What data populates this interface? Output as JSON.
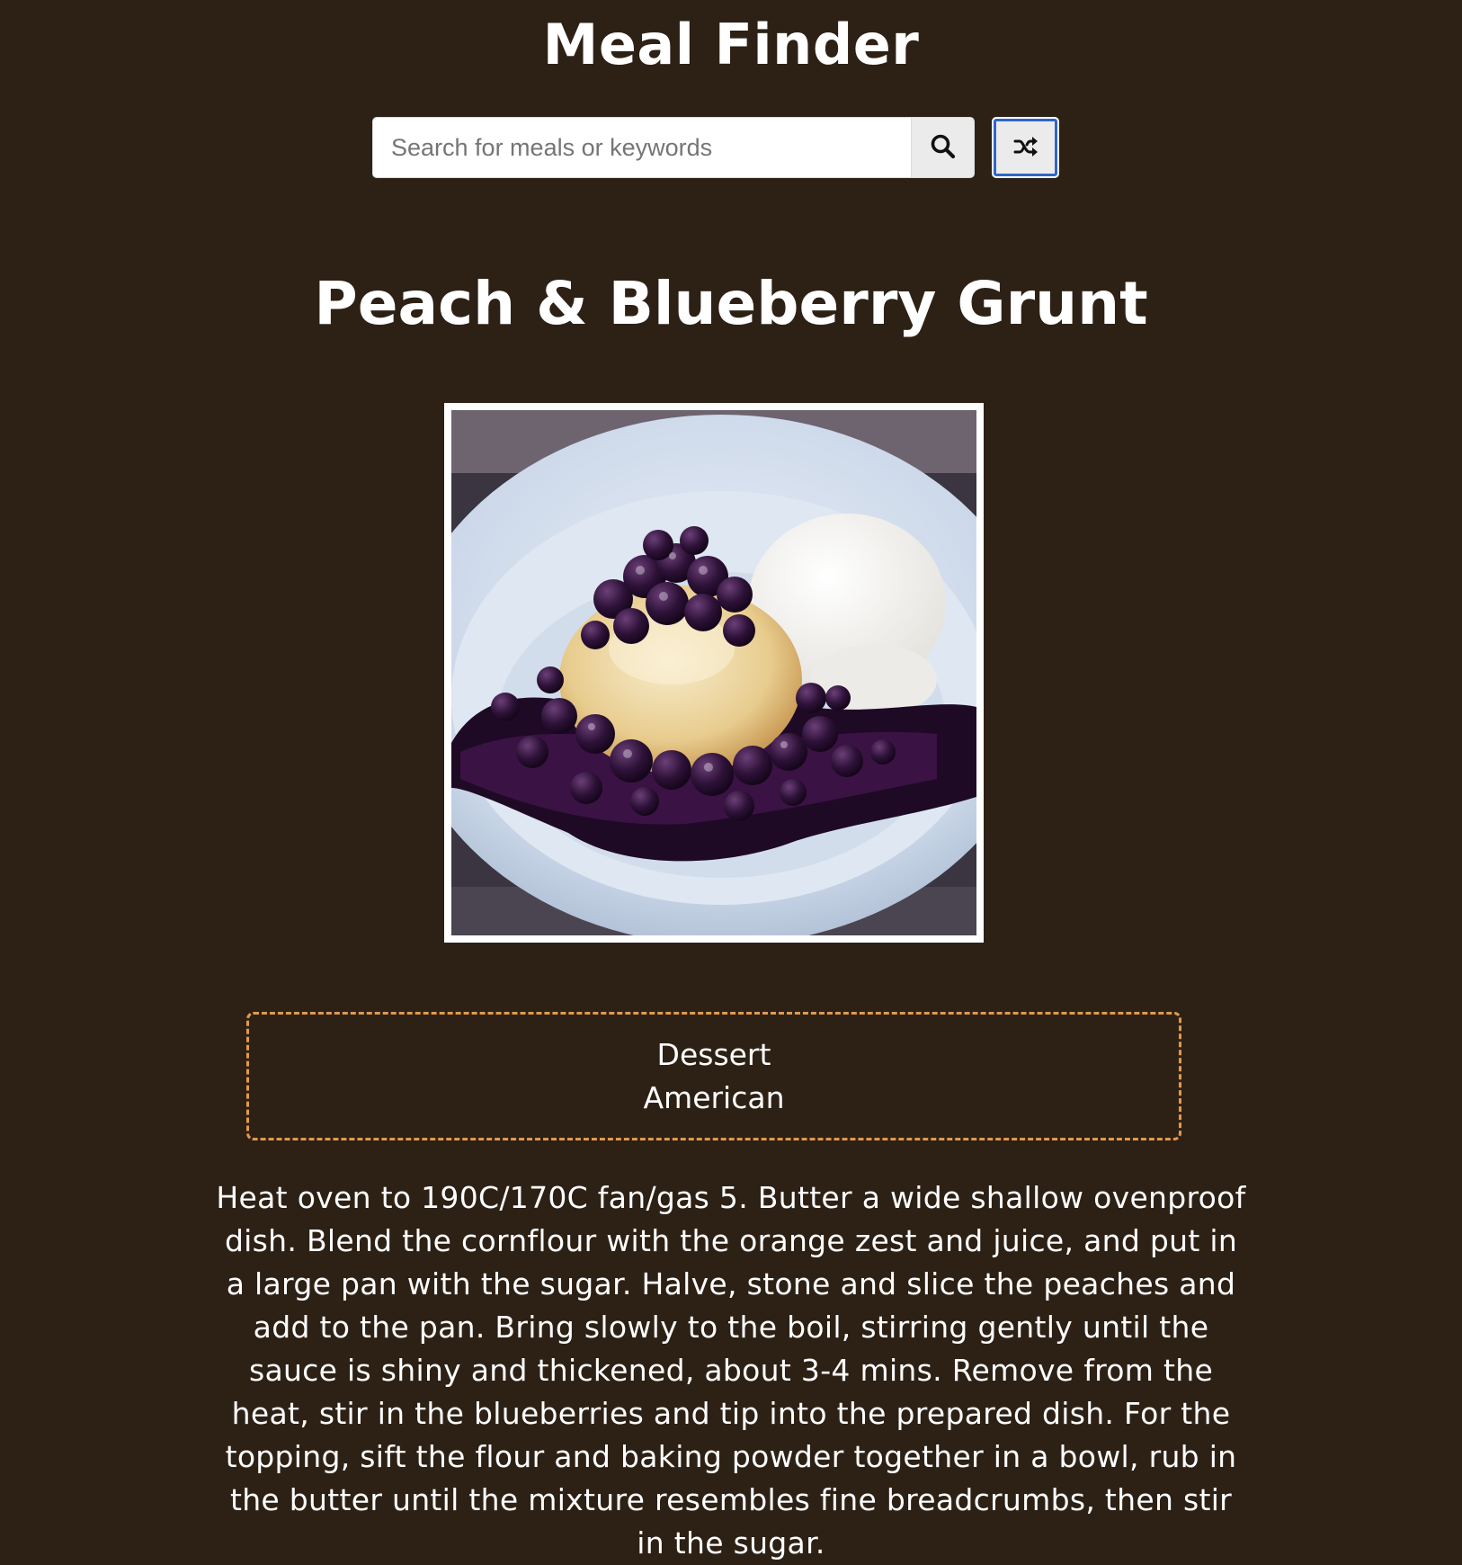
{
  "header": {
    "title": "Meal Finder"
  },
  "search": {
    "placeholder": "Search for meals or keywords",
    "value": "",
    "submit_icon": "search-icon",
    "random_icon": "shuffle-icon"
  },
  "meal": {
    "title": "Peach & Blueberry Grunt",
    "image_description_icon": "meal-photo",
    "category": "Dessert",
    "area": "American",
    "instructions": "Heat oven to 190C/170C fan/gas 5. Butter a wide shallow ovenproof dish. Blend the cornflour with the orange zest and juice, and put in a large pan with the sugar. Halve, stone and slice the peaches and add to the pan. Bring slowly to the boil, stirring gently until the sauce is shiny and thickened, about 3-4 mins. Remove from the heat, stir in the blueberries and tip into the prepared dish. For the topping, sift the flour and baking powder together in a bowl, rub in the butter until the mixture resembles fine breadcrumbs, then stir in the sugar."
  },
  "colors": {
    "background": "#2d2116",
    "accent_border": "#e09a4c",
    "focus_ring": "#2f66c9",
    "text": "#ffffff"
  }
}
